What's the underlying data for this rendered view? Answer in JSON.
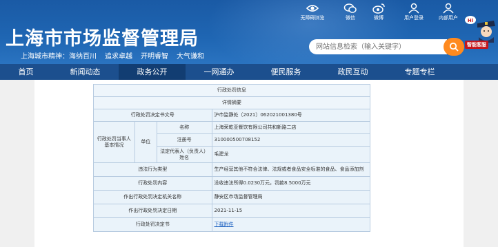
{
  "header": {
    "title": "上海市市场监督管理局",
    "slogan": [
      "上海城市精神：海纳百川",
      "追求卓越",
      "开明睿智",
      "大气谦和"
    ],
    "tools": [
      {
        "label": "无障碍浏览",
        "icon": "eye-icon"
      },
      {
        "label": "微信",
        "icon": "wechat-icon"
      },
      {
        "label": "微博",
        "icon": "weibo-icon"
      },
      {
        "label": "用户登录",
        "icon": "user-icon"
      },
      {
        "label": "内部用户",
        "icon": "internal-user-icon"
      }
    ],
    "search_placeholder": "网站信息检索（输入关键字）",
    "assistant_label": "智能客服",
    "assistant_bubble": "Hi"
  },
  "nav": {
    "items": [
      "首页",
      "新闻动态",
      "政务公开",
      "一网通办",
      "便民服务",
      "政民互动",
      "专题专栏"
    ],
    "active_index": 2
  },
  "record": {
    "title": "行政处罚信息",
    "subtitle": "详情摘要",
    "rows": {
      "doc_no_label": "行政处罚决定书文号",
      "doc_no_value": "沪市监静处〔2021〕062021001380号",
      "party_label": "行政处罚当事人基本情况",
      "unit_label": "单位",
      "name_label": "名称",
      "name_value": "上海荣乾亚餐饮有限公司共和新路二店",
      "reg_label": "注册号",
      "reg_value": "310000500708152",
      "legal_label": "法定代表人（负责人）姓名",
      "legal_value": "毛建龙",
      "violation_label": "违法行为类型",
      "violation_value": "生产经营其他不符合法律、法规或者食品安全标准的食品、食品添加剂",
      "content_label": "行政处罚内容",
      "content_value": "没收违法所得0.0230万元，罚款8.5000万元",
      "authority_label": "作出行政处罚决定机关名称",
      "authority_value": "静安区市场监督管理局",
      "date_label": "作出行政处罚决定日期",
      "date_value": "2021-11-15",
      "decision_label": "行政处罚决定书",
      "decision_value": "下载附件"
    }
  }
}
